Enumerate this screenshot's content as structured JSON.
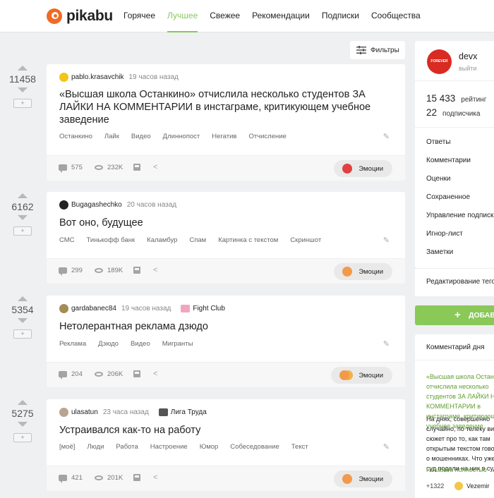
{
  "header": {
    "logo_text": "pikabu",
    "nav": [
      "Горячее",
      "Лучшее",
      "Свежее",
      "Рекомендации",
      "Подписки",
      "Сообщества"
    ],
    "active_nav": "Лучшее",
    "accent_color": "#8ac858"
  },
  "filters": {
    "label": "Фильтры"
  },
  "stories": [
    {
      "rating": "11458",
      "author": "pablo.krasavchik",
      "time": "19 часов назад",
      "community": "",
      "title": "«Высшая школа Останкино» отчислила несколько студентов ЗА ЛАЙКИ НА КОММЕНТАРИИ в инстаграме, критикующем учебное заведение",
      "tags": [
        "Останкино",
        "Лайк",
        "Видео",
        "Длиннопост",
        "Негатив",
        "Отчисление"
      ],
      "comments": "575",
      "views": "232K",
      "emotions_label": "Эмоции"
    },
    {
      "rating": "6162",
      "author": "Bugagashechko",
      "time": "20 часов назад",
      "community": "",
      "title": "Вот оно, будущее",
      "tags": [
        "СМС",
        "Тинькофф банк",
        "Каламбур",
        "Спам",
        "Картинка с текстом",
        "Скриншот"
      ],
      "comments": "299",
      "views": "189K",
      "emotions_label": "Эмоции"
    },
    {
      "rating": "5354",
      "author": "gardabanec84",
      "time": "19 часов назад",
      "community": "Fight Club",
      "title": "Нетолерантная реклама дзюдо",
      "tags": [
        "Реклама",
        "Дзюдо",
        "Видео",
        "Мигранты"
      ],
      "comments": "204",
      "views": "206K",
      "emotions_label": "Эмоции"
    },
    {
      "rating": "5275",
      "author": "ulasatun",
      "time": "23 часа назад",
      "community": "Лига Труда",
      "title": "Устраивался как-то на работу",
      "tags": [
        "[моё]",
        "Люди",
        "Работа",
        "Настроение",
        "Юмор",
        "Собеседование",
        "Текст"
      ],
      "comments": "421",
      "views": "201K",
      "emotions_label": "Эмоции"
    }
  ],
  "sidebar": {
    "avatar_text": "FOREVER ALONE",
    "username": "devx",
    "logout": "выйти",
    "rating_num": "15 433",
    "rating_label": "рейтинг",
    "subs_num": "22",
    "subs_label": "подписчика",
    "menu": [
      "Ответы",
      "Комментарии",
      "Оценки",
      "Сохраненное",
      "Управление подписками",
      "Игнор-лист",
      "Заметки"
    ],
    "settings": "Редактирование тегов",
    "add_button": "ДОБАВИТЬ ПОСТ"
  },
  "comment_of_day": {
    "title": "Комментарий дня",
    "link": "«Высшая школа Останкино» отчислила несколько студентов ЗА ЛАЙКИ НА КОММЕНТАРИИ в инстаграме, критикующем учебное заведение",
    "text": "На днях, совершенно случайно, по телеку видел сюжет про то, как там открытым текстом говорили о мошенниках. Что уже и в суд подали на них в суд и ...",
    "more": "Показать полностью",
    "rating": "+1322",
    "author": "Vezemir"
  }
}
